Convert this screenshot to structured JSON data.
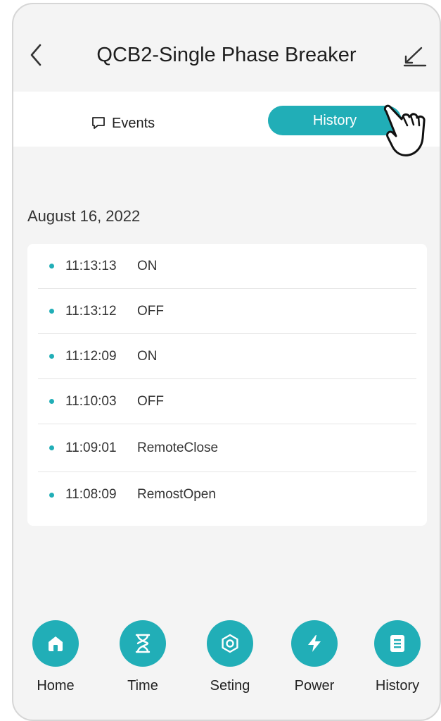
{
  "header": {
    "title": "QCB2-Single Phase Breaker"
  },
  "tabs": {
    "events_label": "Events",
    "history_label": "History"
  },
  "history": {
    "date": "August 16, 2022",
    "entries": [
      {
        "time": "11:13:13",
        "status": "ON"
      },
      {
        "time": "11:13:12",
        "status": "OFF"
      },
      {
        "time": "11:12:09",
        "status": "ON"
      },
      {
        "time": "11:10:03",
        "status": "OFF"
      },
      {
        "time": "11:09:01",
        "status": "RemoteClose"
      },
      {
        "time": "11:08:09",
        "status": "RemostOpen"
      }
    ]
  },
  "nav": {
    "items": [
      {
        "label": "Home",
        "icon": "home-icon"
      },
      {
        "label": "Time",
        "icon": "hourglass-icon"
      },
      {
        "label": "Seting",
        "icon": "settings-icon"
      },
      {
        "label": "Power",
        "icon": "lightning-icon"
      },
      {
        "label": "History",
        "icon": "document-icon"
      }
    ]
  },
  "colors": {
    "accent": "#21aeb7",
    "background": "#f4f4f4"
  }
}
